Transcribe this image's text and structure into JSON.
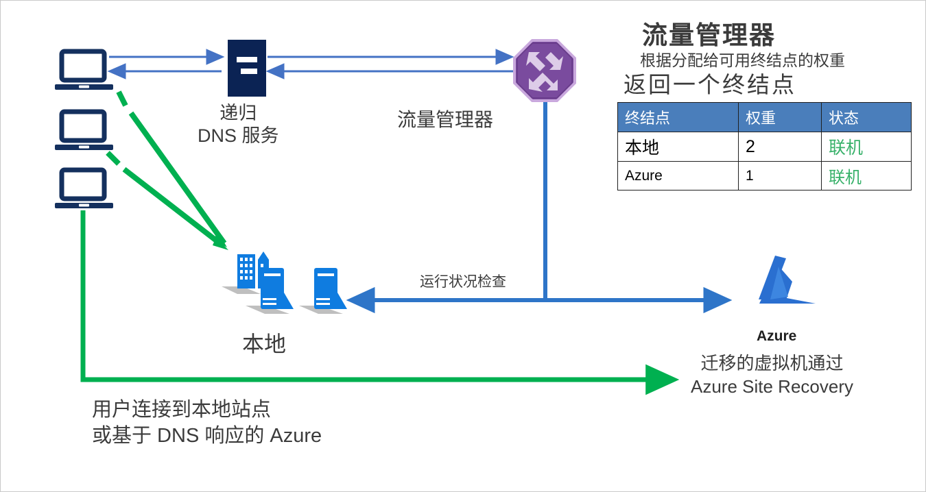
{
  "diagram": {
    "title_block": {
      "title": "流量管理器",
      "subtitle": "根据分配给可用终结点的权重",
      "subtitle2": "返回一个终结点"
    },
    "endpoint_table": {
      "headers": [
        "终结点",
        "权重",
        "状态"
      ],
      "rows": [
        {
          "endpoint": "本地",
          "weight": "2",
          "status": "联机"
        },
        {
          "endpoint": "Azure",
          "weight": "1",
          "status": "联机"
        }
      ]
    },
    "labels": {
      "dns_service": "递归\nDNS 服务",
      "dns_service_line1": "递归",
      "dns_service_line2": "DNS 服务",
      "traffic_manager": "流量管理器",
      "health_check": "运行状况检查",
      "on_premises": "本地",
      "azure": "Azure",
      "azure_sub_line1": "迁移的虚拟机通过",
      "azure_sub_line2": "Azure Site Recovery",
      "caption_line1": "用户连接到本地站点",
      "caption_line2": "或基于 DNS 响应的 Azure"
    },
    "icons": {
      "laptop_1": "laptop-icon",
      "laptop_2": "laptop-icon",
      "laptop_3": "laptop-icon",
      "dns_server": "server-rack-icon",
      "traffic_manager": "traffic-manager-octagon-icon",
      "on_premises": "on-premises-datacenter-icon",
      "azure": "azure-logo-icon"
    },
    "colors": {
      "arrow_blue_thin": "#4472c4",
      "arrow_blue_thick": "#2e75c8",
      "arrow_green": "#00b050",
      "device_navy": "#14305e",
      "azure_blue": "#0f7ce0",
      "tm_purple": "#7a4b9e",
      "table_header_bg": "#4a7ebb",
      "status_green": "#38b16a",
      "text_gray": "#3b3b3b",
      "background": "#ffffff"
    }
  }
}
